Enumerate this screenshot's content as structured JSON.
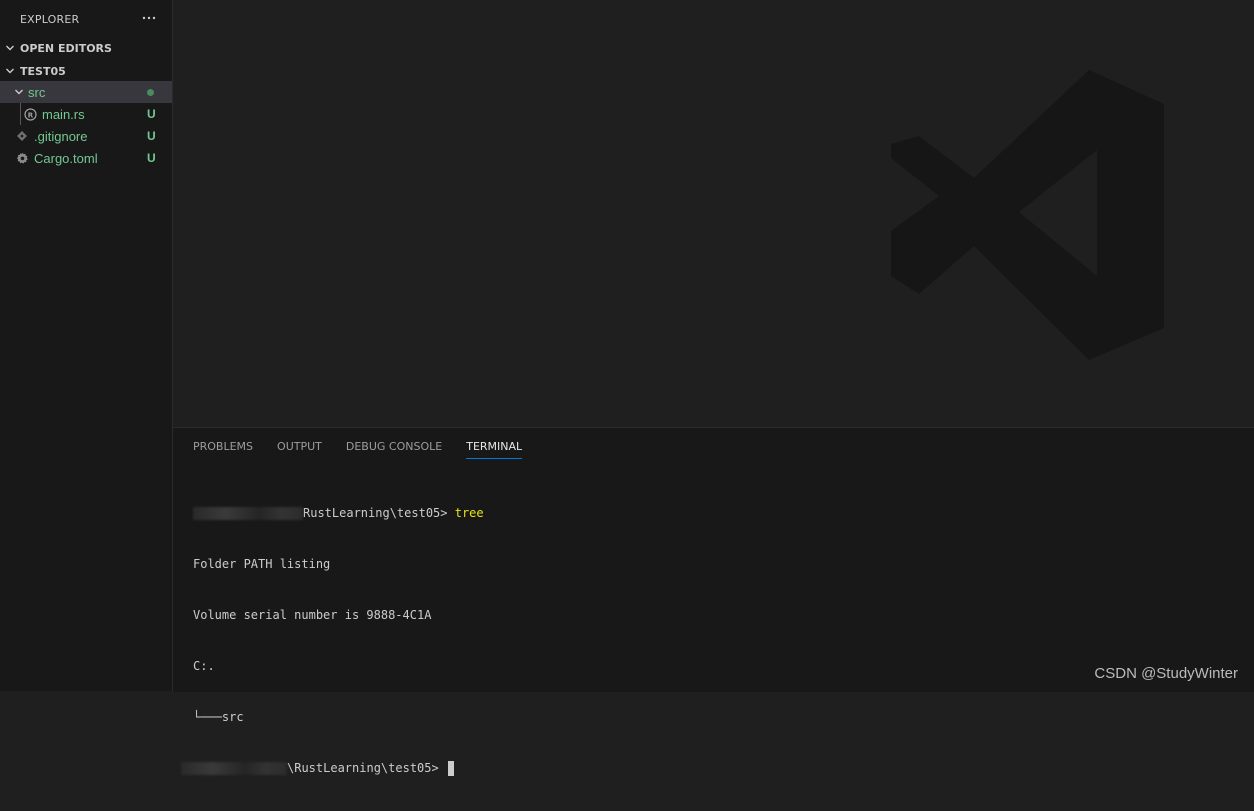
{
  "sidebar": {
    "title": "EXPLORER",
    "open_editors": "OPEN EDITORS",
    "folder": "TEST05",
    "items": [
      {
        "label": "src",
        "status": "dot",
        "icon": "chevron-down-icon"
      },
      {
        "label": "main.rs",
        "status": "U",
        "icon": "rust-file-icon"
      },
      {
        "label": ".gitignore",
        "status": "U",
        "icon": "git-icon"
      },
      {
        "label": "Cargo.toml",
        "status": "U",
        "icon": "gear-icon"
      }
    ]
  },
  "panel": {
    "tabs": [
      "PROBLEMS",
      "OUTPUT",
      "DEBUG CONSOLE",
      "TERMINAL"
    ],
    "active_tab": "TERMINAL",
    "terminal": {
      "prompt1_path": "RustLearning\\test05> ",
      "command": "tree",
      "lines": [
        "Folder PATH listing",
        "Volume serial number is 9888-4C1A",
        "C:.",
        "└───src"
      ],
      "prompt2_path": "\\RustLearning\\test05> "
    }
  },
  "watermark_text": "CSDN @StudyWinter",
  "colors": {
    "untracked": "#73c991",
    "accent": "#0078d4",
    "command": "#e5e510"
  }
}
